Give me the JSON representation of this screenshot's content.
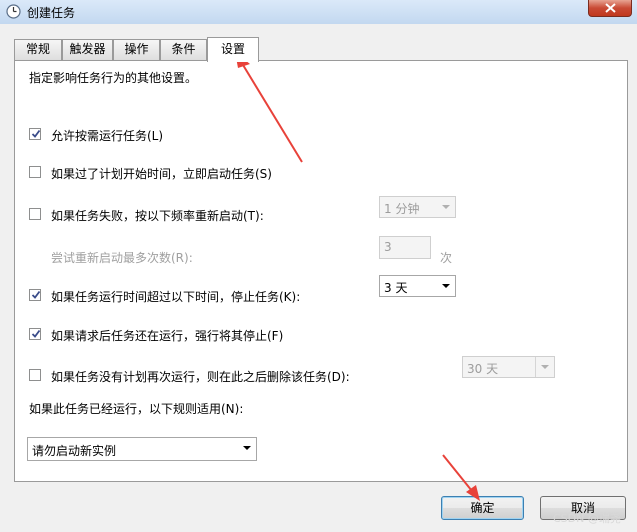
{
  "window": {
    "title": "创建任务",
    "title_icon": "clock-icon",
    "close_icon": "close-icon"
  },
  "tabs": [
    {
      "label": "常规"
    },
    {
      "label": "触发器"
    },
    {
      "label": "操作"
    },
    {
      "label": "条件"
    },
    {
      "label": "设置",
      "active": true
    }
  ],
  "settings": {
    "description": "指定影响任务行为的其他设置。",
    "allow_on_demand": {
      "label": "允许按需运行任务(L)",
      "checked": true
    },
    "start_if_missed": {
      "label": "如果过了计划开始时间，立即启动任务(S)",
      "checked": false
    },
    "restart_on_fail": {
      "label": "如果任务失败，按以下频率重新启动(T):",
      "checked": false,
      "interval": "1 分钟"
    },
    "retry_attempts": {
      "label": "尝试重新启动最多次数(R):",
      "value": "3",
      "unit": "次"
    },
    "stop_if_runs_longer": {
      "label": "如果任务运行时间超过以下时间，停止任务(K):",
      "checked": true,
      "duration": "3 天"
    },
    "force_stop": {
      "label": "如果请求后任务还在运行，强行将其停止(F)",
      "checked": true
    },
    "delete_if_not_scheduled": {
      "label": "如果任务没有计划再次运行，则在此之后删除该任务(D):",
      "checked": false,
      "duration": "30 天"
    },
    "running_rule_label": "如果此任务已经运行，以下规则适用(N):",
    "running_rule_value": "请勿启动新实例"
  },
  "buttons": {
    "ok": "确定",
    "cancel": "取消"
  },
  "watermark": "CSDN @瑞尧",
  "colors": {
    "annotation_arrow": "#e8423a",
    "close_button": "#c94a35"
  }
}
